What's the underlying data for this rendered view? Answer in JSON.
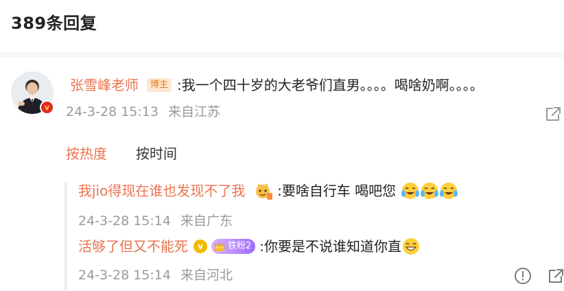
{
  "header": {
    "title": "389条回复"
  },
  "main_comment": {
    "username": "张雪峰老师",
    "tag": "博主",
    "text": ":我一个四十岁的大老爷们直男。。。。喝啥奶啊。。。。",
    "time": "24-3-28 15:13",
    "source": "来自江苏",
    "verified_badge": "v"
  },
  "sort_tabs": [
    {
      "label": "按热度",
      "active": true
    },
    {
      "label": "按时间",
      "active": false
    }
  ],
  "replies": [
    {
      "username": "我jio得现在谁也发现不了我",
      "text": ":要啥自行车 喝吧您",
      "emoji": [
        "crying-laughing",
        "crying-laughing",
        "crying-laughing"
      ],
      "time": "24-3-28 15:14",
      "source": "来自广东"
    },
    {
      "username": "活够了但又不能死",
      "verified_badge": "v",
      "fan_badge": "铁粉2",
      "text": ":你要是不说谁知道你直",
      "emoji": [
        "grinning"
      ],
      "time": "24-3-28 15:14",
      "source": "来自河北"
    }
  ],
  "icons": {
    "share": "share-icon",
    "report": "report-icon",
    "more": "more-icon"
  },
  "colors": {
    "username": "#eb7350",
    "meta": "#9a9a9a",
    "active_tab": "#eb7350"
  }
}
